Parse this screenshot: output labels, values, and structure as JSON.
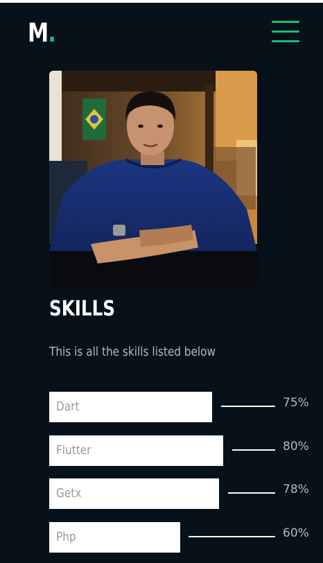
{
  "header": {
    "logo_letter": "M",
    "logo_dot": ".",
    "menu_icon": "hamburger-menu-icon",
    "accent_color": "#1bbd74"
  },
  "profile": {
    "photo": "portrait-photo"
  },
  "skills": {
    "title": "SKILLS",
    "subtitle": "This is all the skills listed below",
    "items": [
      {
        "name": "Dart",
        "percent_label": "75%",
        "level": 0.75
      },
      {
        "name": "Flutter",
        "percent_label": "80%",
        "level": 0.8
      },
      {
        "name": "Getx",
        "percent_label": "78%",
        "level": 0.78
      },
      {
        "name": "Php",
        "percent_label": "60%",
        "level": 0.6
      }
    ]
  },
  "colors": {
    "background": "#07111a",
    "text": "#ffffff",
    "muted_text": "#b4b9bf"
  }
}
